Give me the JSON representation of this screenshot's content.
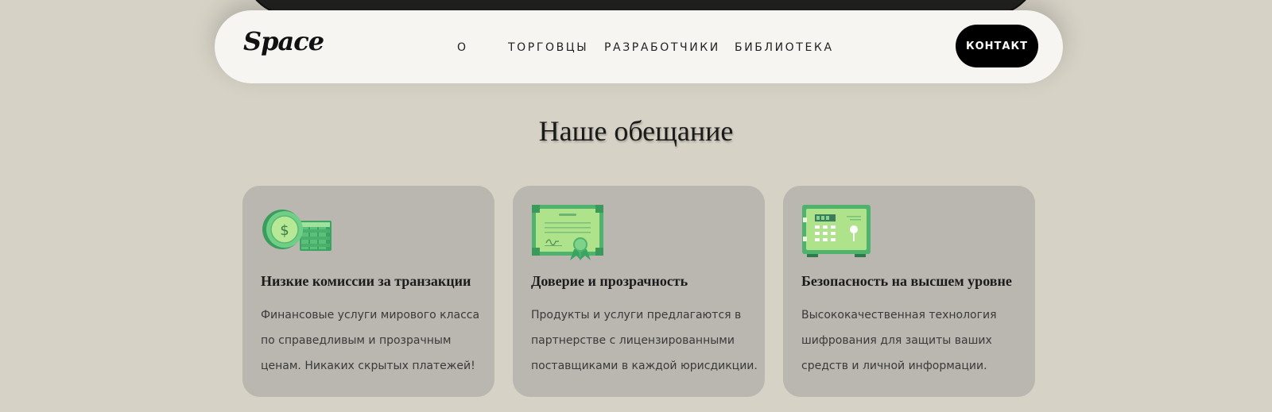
{
  "nav": {
    "logo": "Space",
    "links": [
      "О",
      "Торговцы",
      "Разработчики",
      "Библиотека"
    ],
    "contact_label": "КОНТАКТ"
  },
  "section": {
    "title": "Наше обещание"
  },
  "cards": [
    {
      "icon": "coins-icon",
      "title": "Низкие комиссии за транзакции",
      "text": "Финансовые услуги мирового класса по справедливым и прозрачным ценам. Никаких скрытых платежей!"
    },
    {
      "icon": "certificate-icon",
      "title": "Доверие и прозрачность",
      "text": "Продукты и услуги предлагаются в партнерстве с лицензированными поставщиками в каждой юрисдикции."
    },
    {
      "icon": "safe-icon",
      "title": "Безопасность на высшем уровне",
      "text": "Высококачественная технология шифрования для защиты ваших средств и личной информации."
    }
  ],
  "colors": {
    "background": "#d6d2c6",
    "card": "#bab6b0",
    "accent_green": "#7dd38a",
    "button": "#000000"
  }
}
